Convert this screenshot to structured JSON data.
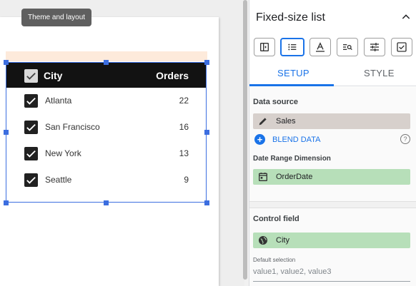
{
  "tooltip": "Theme and layout",
  "list": {
    "header": {
      "dimension": "City",
      "metric": "Orders"
    },
    "rows": [
      {
        "city": "Atlanta",
        "value": "22"
      },
      {
        "city": "San Francisco",
        "value": "16"
      },
      {
        "city": "New York",
        "value": "13"
      },
      {
        "city": "Seattle",
        "value": "9"
      }
    ]
  },
  "panel": {
    "title": "Fixed-size list",
    "toolbar": [
      {
        "name": "layout-icon"
      },
      {
        "name": "list-icon",
        "active": true
      },
      {
        "name": "text-format-icon"
      },
      {
        "name": "search-list-icon"
      },
      {
        "name": "tune-icon"
      },
      {
        "name": "checkbox-icon"
      }
    ],
    "tabs": {
      "setup": "SETUP",
      "style": "STYLE"
    },
    "data_source_label": "Data source",
    "data_source": "Sales",
    "blend": "BLEND DATA",
    "date_range_label": "Date Range Dimension",
    "date_range": "OrderDate",
    "control_field_label": "Control field",
    "control_field": "City",
    "default_selection_label": "Default selection",
    "default_selection_placeholder": "value1, value2, value3"
  },
  "colors": {
    "accent": "#1a73e8",
    "header": "#121212",
    "green_chip": "#b7dfb9",
    "gray_chip": "#d7d0cc"
  }
}
